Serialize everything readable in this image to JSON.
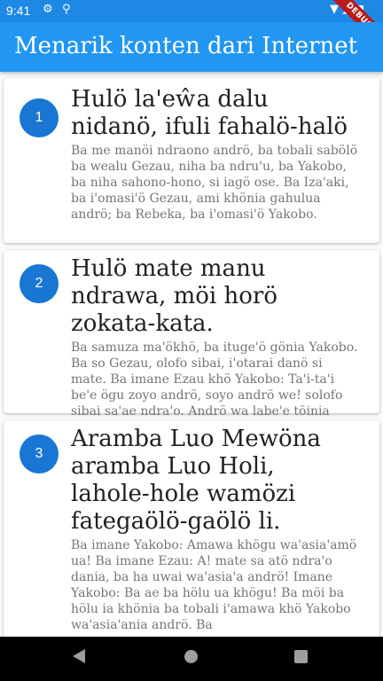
{
  "status_bar": {
    "time": "9:41",
    "icons": [
      "gear-icon",
      "usb-icon",
      "wifi-icon",
      "signal-icon",
      "battery-icon"
    ]
  },
  "debug_banner": "DEBUG",
  "app_bar": {
    "title": "Menarik konten dari Internet",
    "color": "#2196f3"
  },
  "items": [
    {
      "number": "1",
      "title": "Hulö la'eŵa dalu nidanö, ifuli fahalö-halö",
      "body": "Ba me manöi ndraono andrö, ba tobali sabölö ba wealu Gezau, niha ba ndru'u, ba Yakobo, ba niha sahono-hono, si iagö ose. Ba Iza'aki, ba i'omasi'ö Gezau, ami khönia gahulua andrö; ba Rebeka, ba i'omasi'ö Yakobo."
    },
    {
      "number": "2",
      "title": "Hulö mate manu ndrawa, möi horö zokata-kata.",
      "body": "Ba samuza ma'ökhö, ba ituge'ö gönia Yakobo. Ba so Gezau, olofo sibai, i'otarai danö si mate. Ba imane Ezau khö Yakobo: Ta'i-ta'i be'e ögu zoyo andrö, soyo andrö we! solofo sibai sa'ae ndra'o. Andrö wa labe'e töinia Gedomo (Soyo)."
    },
    {
      "number": "3",
      "title": "Aramba Luo Mewöna aramba Luo Holi, lahole-hole wamözi fategaölö-gaölö li.",
      "body": "Ba imane Yakobo: Amawa khögu wa'asia'amö ua! Ba imane Ezau: A! mate sa atö ndra'o dania, ba ha uwai wa'asia'a andrö! Imane Yakobo: Ba ae ba hölu ua khögu! Ba möi ba hölu ia khönia ba tobali i'amawa khö Yakobo wa'asia'ania andrö. Ba"
    }
  ]
}
